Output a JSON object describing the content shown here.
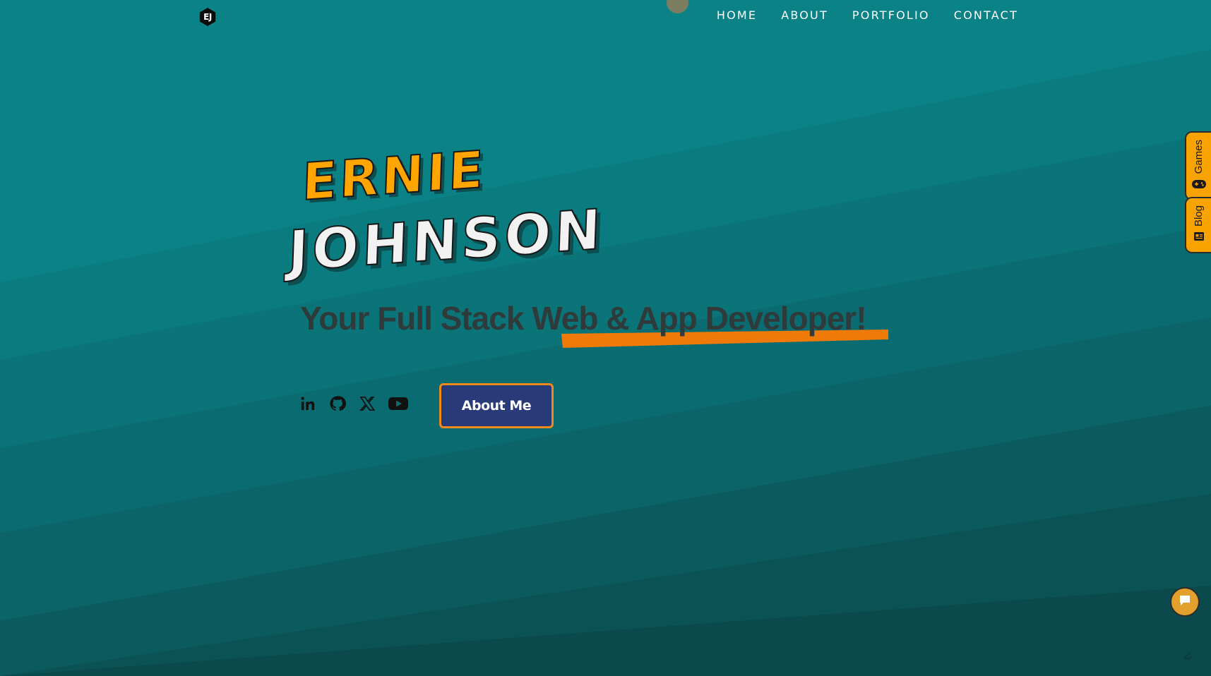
{
  "logo": {
    "text": "EJ"
  },
  "nav": {
    "items": [
      {
        "label": "HOME"
      },
      {
        "label": "ABOUT"
      },
      {
        "label": "PORTFOLIO"
      },
      {
        "label": "CONTACT"
      }
    ]
  },
  "hero": {
    "first_name": "ERNIE",
    "last_name": "JOHNSON",
    "tagline_prefix": "Your Full Stack ",
    "tagline_highlight": "Web & App Developer!"
  },
  "socials": [
    {
      "icon": "linkedin-icon"
    },
    {
      "icon": "github-icon"
    },
    {
      "icon": "x-twitter-icon"
    },
    {
      "icon": "youtube-icon"
    }
  ],
  "cta": {
    "label": "About Me"
  },
  "side_tabs": [
    {
      "label": "Games",
      "icon": "gamepad-icon"
    },
    {
      "label": "Blog",
      "icon": "blog-icon"
    }
  ],
  "colors": {
    "accent_orange": "#ffa500",
    "underline_orange": "#f07a08",
    "button_navy": "#283a78",
    "teal_light": "#0a8286",
    "teal_dark": "#0b4a4c"
  }
}
